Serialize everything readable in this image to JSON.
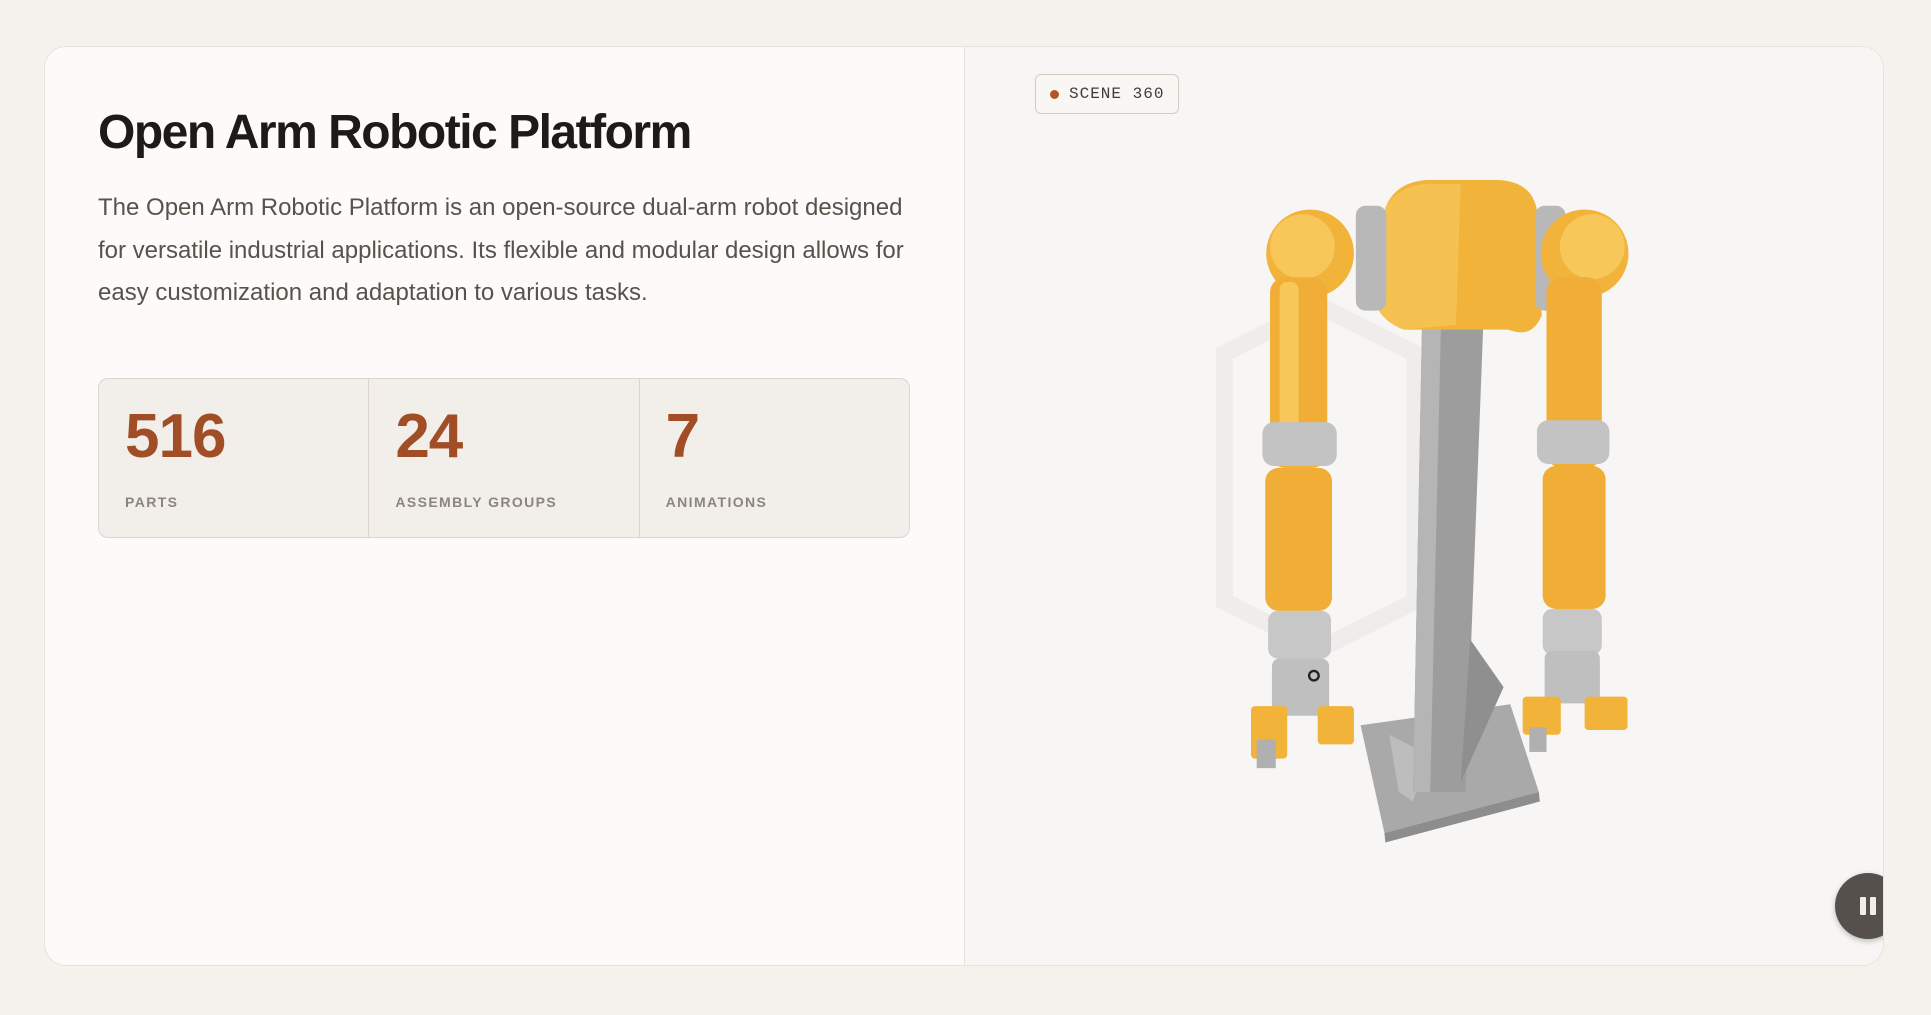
{
  "panel": {
    "title": "Open Arm Robotic Platform",
    "description": "The Open Arm Robotic Platform is an open-source dual-arm robot designed for versatile industrial applications. Its flexible and modular design allows for easy customization and adaptation to various tasks."
  },
  "stats": [
    {
      "value": "516",
      "label": "PARTS"
    },
    {
      "value": "24",
      "label": "ASSEMBLY GROUPS"
    },
    {
      "value": "7",
      "label": "ANIMATIONS"
    }
  ],
  "viewer": {
    "badge": "SCENE 360",
    "model_icon": "robot-arm-model",
    "controls": {
      "pause_icon": "pause-icon"
    }
  },
  "colors": {
    "accent": "#a14d25",
    "robot_yellow": "#f5b93d",
    "robot_gray": "#9a9a9a",
    "badge_dot": "#b2552b"
  }
}
